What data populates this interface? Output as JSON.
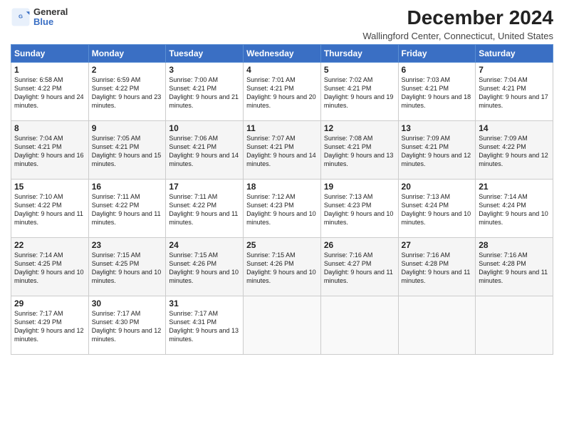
{
  "header": {
    "logo_general": "General",
    "logo_blue": "Blue",
    "month_title": "December 2024",
    "subtitle": "Wallingford Center, Connecticut, United States"
  },
  "days_of_week": [
    "Sunday",
    "Monday",
    "Tuesday",
    "Wednesday",
    "Thursday",
    "Friday",
    "Saturday"
  ],
  "weeks": [
    [
      {
        "day": "1",
        "sunrise": "6:58 AM",
        "sunset": "4:22 PM",
        "daylight": "9 hours and 24 minutes."
      },
      {
        "day": "2",
        "sunrise": "6:59 AM",
        "sunset": "4:22 PM",
        "daylight": "9 hours and 23 minutes."
      },
      {
        "day": "3",
        "sunrise": "7:00 AM",
        "sunset": "4:21 PM",
        "daylight": "9 hours and 21 minutes."
      },
      {
        "day": "4",
        "sunrise": "7:01 AM",
        "sunset": "4:21 PM",
        "daylight": "9 hours and 20 minutes."
      },
      {
        "day": "5",
        "sunrise": "7:02 AM",
        "sunset": "4:21 PM",
        "daylight": "9 hours and 19 minutes."
      },
      {
        "day": "6",
        "sunrise": "7:03 AM",
        "sunset": "4:21 PM",
        "daylight": "9 hours and 18 minutes."
      },
      {
        "day": "7",
        "sunrise": "7:04 AM",
        "sunset": "4:21 PM",
        "daylight": "9 hours and 17 minutes."
      }
    ],
    [
      {
        "day": "8",
        "sunrise": "7:04 AM",
        "sunset": "4:21 PM",
        "daylight": "9 hours and 16 minutes."
      },
      {
        "day": "9",
        "sunrise": "7:05 AM",
        "sunset": "4:21 PM",
        "daylight": "9 hours and 15 minutes."
      },
      {
        "day": "10",
        "sunrise": "7:06 AM",
        "sunset": "4:21 PM",
        "daylight": "9 hours and 14 minutes."
      },
      {
        "day": "11",
        "sunrise": "7:07 AM",
        "sunset": "4:21 PM",
        "daylight": "9 hours and 14 minutes."
      },
      {
        "day": "12",
        "sunrise": "7:08 AM",
        "sunset": "4:21 PM",
        "daylight": "9 hours and 13 minutes."
      },
      {
        "day": "13",
        "sunrise": "7:09 AM",
        "sunset": "4:21 PM",
        "daylight": "9 hours and 12 minutes."
      },
      {
        "day": "14",
        "sunrise": "7:09 AM",
        "sunset": "4:22 PM",
        "daylight": "9 hours and 12 minutes."
      }
    ],
    [
      {
        "day": "15",
        "sunrise": "7:10 AM",
        "sunset": "4:22 PM",
        "daylight": "9 hours and 11 minutes."
      },
      {
        "day": "16",
        "sunrise": "7:11 AM",
        "sunset": "4:22 PM",
        "daylight": "9 hours and 11 minutes."
      },
      {
        "day": "17",
        "sunrise": "7:11 AM",
        "sunset": "4:22 PM",
        "daylight": "9 hours and 11 minutes."
      },
      {
        "day": "18",
        "sunrise": "7:12 AM",
        "sunset": "4:23 PM",
        "daylight": "9 hours and 10 minutes."
      },
      {
        "day": "19",
        "sunrise": "7:13 AM",
        "sunset": "4:23 PM",
        "daylight": "9 hours and 10 minutes."
      },
      {
        "day": "20",
        "sunrise": "7:13 AM",
        "sunset": "4:24 PM",
        "daylight": "9 hours and 10 minutes."
      },
      {
        "day": "21",
        "sunrise": "7:14 AM",
        "sunset": "4:24 PM",
        "daylight": "9 hours and 10 minutes."
      }
    ],
    [
      {
        "day": "22",
        "sunrise": "7:14 AM",
        "sunset": "4:25 PM",
        "daylight": "9 hours and 10 minutes."
      },
      {
        "day": "23",
        "sunrise": "7:15 AM",
        "sunset": "4:25 PM",
        "daylight": "9 hours and 10 minutes."
      },
      {
        "day": "24",
        "sunrise": "7:15 AM",
        "sunset": "4:26 PM",
        "daylight": "9 hours and 10 minutes."
      },
      {
        "day": "25",
        "sunrise": "7:15 AM",
        "sunset": "4:26 PM",
        "daylight": "9 hours and 10 minutes."
      },
      {
        "day": "26",
        "sunrise": "7:16 AM",
        "sunset": "4:27 PM",
        "daylight": "9 hours and 11 minutes."
      },
      {
        "day": "27",
        "sunrise": "7:16 AM",
        "sunset": "4:28 PM",
        "daylight": "9 hours and 11 minutes."
      },
      {
        "day": "28",
        "sunrise": "7:16 AM",
        "sunset": "4:28 PM",
        "daylight": "9 hours and 11 minutes."
      }
    ],
    [
      {
        "day": "29",
        "sunrise": "7:17 AM",
        "sunset": "4:29 PM",
        "daylight": "9 hours and 12 minutes."
      },
      {
        "day": "30",
        "sunrise": "7:17 AM",
        "sunset": "4:30 PM",
        "daylight": "9 hours and 12 minutes."
      },
      {
        "day": "31",
        "sunrise": "7:17 AM",
        "sunset": "4:31 PM",
        "daylight": "9 hours and 13 minutes."
      },
      null,
      null,
      null,
      null
    ]
  ]
}
